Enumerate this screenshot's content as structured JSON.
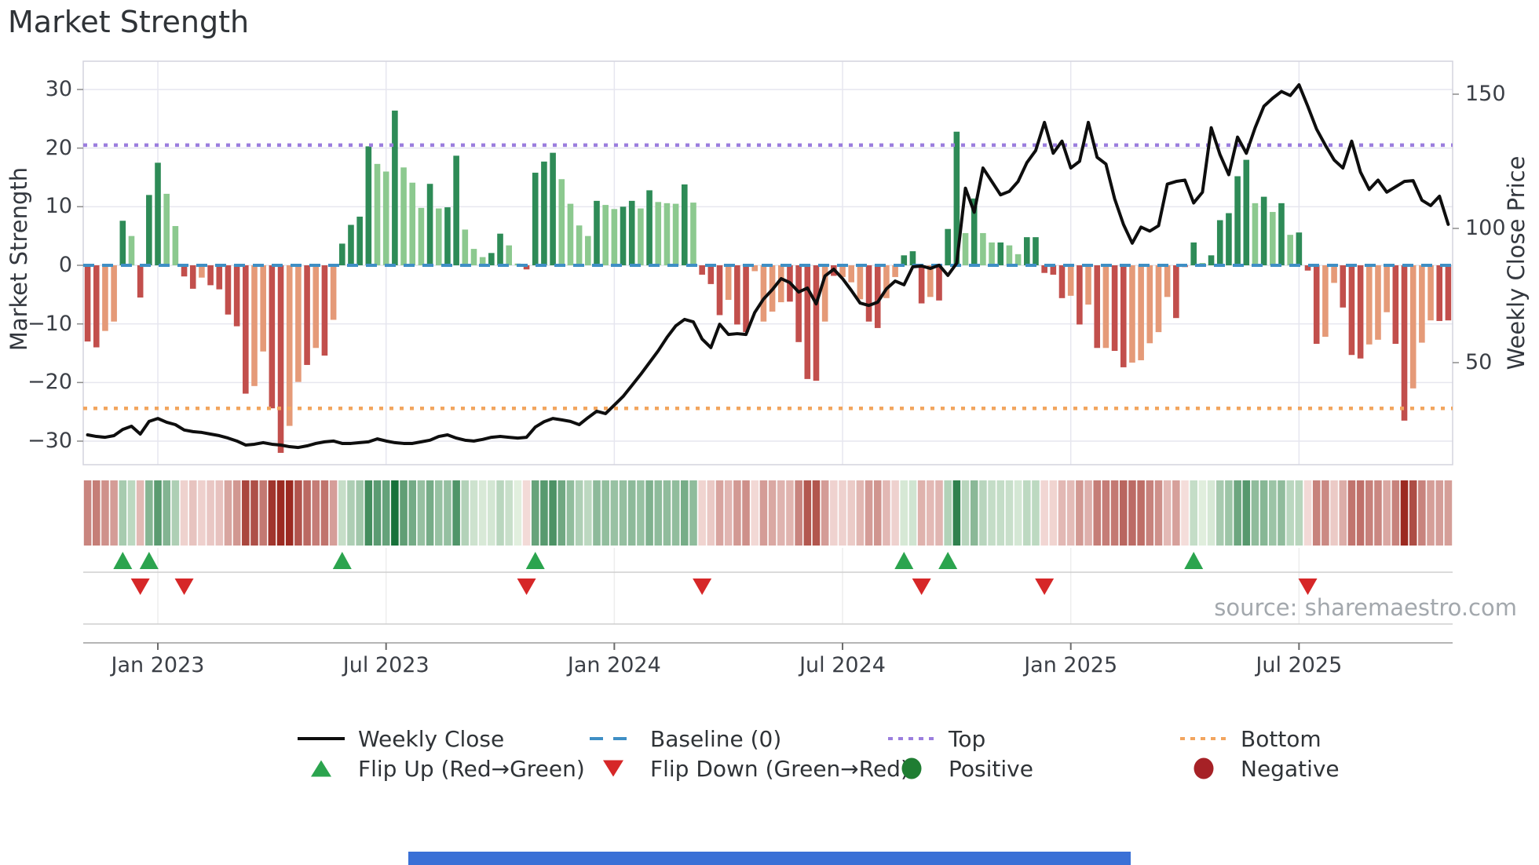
{
  "title": "Market Strength",
  "source": "source: sharemaestro.com",
  "chart_data": {
    "type": "combo",
    "title": "Market Strength",
    "ylabel_left": "Market Strength",
    "ylabel_right": "Weekly Close Price",
    "x_tick_labels": [
      "Jan 2023",
      "Jul 2023",
      "Jan 2024",
      "Jul 2024",
      "Jan 2025",
      "Jul 2025"
    ],
    "x_tick_weeks": [
      8,
      34,
      60,
      86,
      112,
      138
    ],
    "y_ticks_left_values": [
      30,
      20,
      10,
      0,
      -10,
      -20,
      -30
    ],
    "y_ticks_left_labels": [
      "30",
      "20",
      "10",
      "0",
      "−10",
      "−20",
      "−30"
    ],
    "y_ticks_right_values": [
      150,
      100,
      50
    ],
    "y_ticks_right_labels": [
      "150",
      "100",
      "50"
    ],
    "ylim_left": [
      -34,
      35
    ],
    "ylim_right": [
      12,
      162
    ],
    "grid": true,
    "legend_position": "bottom",
    "baseline": 0,
    "top_line": 20.5,
    "bottom_line": -24.4,
    "n_weeks": 156,
    "strength": [
      -13,
      -14,
      -11.2,
      -9.6,
      7.6,
      5,
      -5.5,
      12,
      17.5,
      12.2,
      6.7,
      -1.9,
      -4,
      -2.1,
      -3.4,
      -4.1,
      -8.4,
      -10.4,
      -21.9,
      -20.6,
      -14.7,
      -24.4,
      -32,
      -27.4,
      -19.9,
      -17,
      -14.1,
      -15.4,
      -9.3,
      3.7,
      6.9,
      8.3,
      20.3,
      17.3,
      16,
      26.4,
      16.7,
      14.1,
      9.8,
      13.9,
      9.7,
      9.9,
      18.7,
      6.1,
      2.8,
      1.4,
      2.1,
      5.4,
      3.4,
      0.3,
      -0.7,
      15.8,
      17.7,
      19.2,
      14.7,
      10.5,
      6.8,
      5,
      11,
      10.3,
      9.6,
      10,
      11,
      9.7,
      12.8,
      10.8,
      10.6,
      10.5,
      13.8,
      10.7,
      -1.6,
      -3.2,
      -8.5,
      -5.9,
      -10.1,
      -11.4,
      -1,
      -9.6,
      -7.9,
      -6.3,
      -6.2,
      -13.1,
      -19.4,
      -19.7,
      -9.6,
      -1.8,
      -2,
      -2.9,
      -5.8,
      -9.6,
      -10.7,
      -5.6,
      -2,
      1.7,
      2.4,
      -6.5,
      -5.4,
      -6,
      6.2,
      22.8,
      5.5,
      11.4,
      5.5,
      3.9,
      3.9,
      3.4,
      1.9,
      4.8,
      4.8,
      -1.3,
      -1.6,
      -5.6,
      -5.2,
      -10.1,
      -6.7,
      -14.1,
      -14.1,
      -14.6,
      -17.4,
      -16.6,
      -16.2,
      -13.3,
      -11.4,
      -5.4,
      -9,
      -0.3,
      3.9,
      0.4,
      1.7,
      7.7,
      8.9,
      15.2,
      18,
      10.6,
      11.7,
      9.1,
      10.6,
      5.2,
      5.6,
      -0.9,
      -13.4,
      -12.2,
      -3,
      -7.2,
      -15.3,
      -15.9,
      -13.5,
      -12.7,
      -8,
      -13.4,
      -26.5,
      -21,
      -13.2,
      -9.4,
      -9.5,
      -9.4
    ],
    "shade": [
      "dr",
      "dr",
      "lr",
      "lr",
      "dg",
      "lg",
      "dr",
      "dg",
      "dg",
      "lg",
      "lg",
      "dr",
      "dr",
      "lr",
      "dr",
      "dr",
      "dr",
      "dr",
      "dr",
      "lr",
      "lr",
      "dr",
      "dr",
      "lr",
      "lr",
      "dr",
      "lr",
      "dr",
      "lr",
      "dg",
      "dg",
      "dg",
      "dg",
      "lg",
      "lg",
      "dg",
      "lg",
      "lg",
      "lg",
      "dg",
      "lg",
      "dg",
      "dg",
      "lg",
      "lg",
      "lg",
      "dg",
      "dg",
      "lg",
      "lg",
      "dr",
      "dg",
      "dg",
      "dg",
      "lg",
      "lg",
      "lg",
      "lg",
      "dg",
      "lg",
      "lg",
      "dg",
      "dg",
      "lg",
      "dg",
      "lg",
      "lg",
      "lg",
      "dg",
      "lg",
      "dr",
      "dr",
      "dr",
      "lr",
      "dr",
      "dr",
      "lr",
      "lr",
      "lr",
      "lr",
      "dr",
      "dr",
      "dr",
      "dr",
      "lr",
      "dr",
      "lr",
      "lr",
      "lr",
      "dr",
      "dr",
      "lr",
      "lr",
      "dg",
      "dg",
      "dr",
      "lr",
      "dr",
      "dg",
      "dg",
      "lg",
      "dg",
      "lg",
      "lg",
      "dg",
      "lg",
      "lg",
      "dg",
      "dg",
      "dr",
      "dr",
      "dr",
      "lr",
      "dr",
      "lr",
      "dr",
      "lr",
      "dr",
      "dr",
      "lr",
      "lr",
      "lr",
      "lr",
      "lr",
      "dr",
      "dr",
      "dg",
      "lg",
      "dg",
      "dg",
      "dg",
      "dg",
      "dg",
      "lg",
      "dg",
      "lg",
      "dg",
      "lg",
      "dg",
      "dr",
      "dr",
      "lr",
      "lr",
      "dr",
      "dr",
      "dr",
      "lr",
      "lr",
      "lr",
      "dr",
      "dr",
      "lr",
      "lr",
      "lr",
      "dr",
      "dr"
    ],
    "weekly_close": [
      23.1,
      22.5,
      22.2,
      22.8,
      25.1,
      26.3,
      23.4,
      28.1,
      29.2,
      27.8,
      26.9,
      24.9,
      24.3,
      24,
      23.4,
      22.8,
      21.9,
      20.8,
      19.3,
      19.6,
      20.2,
      19.6,
      19.3,
      18.7,
      18.4,
      19,
      19.9,
      20.5,
      20.8,
      19.9,
      19.9,
      20.2,
      20.5,
      21.6,
      20.8,
      20.2,
      19.9,
      19.9,
      20.5,
      21.1,
      22.5,
      23.1,
      21.9,
      21.1,
      20.8,
      21.4,
      22.2,
      22.5,
      22.2,
      21.9,
      22.2,
      26,
      28,
      29.2,
      28.7,
      28.1,
      26.9,
      29.5,
      31.9,
      31,
      34.2,
      37.4,
      41.5,
      45.6,
      50,
      54.4,
      59.4,
      63.7,
      66.1,
      65.2,
      58.8,
      55.6,
      64.3,
      60.5,
      60.8,
      60.5,
      68.7,
      73.7,
      77.2,
      81.3,
      79.8,
      76.3,
      77.8,
      71.9,
      82.3,
      84.8,
      81.3,
      76.9,
      72.2,
      71.3,
      72.5,
      77.5,
      80.4,
      79,
      85.7,
      86,
      85.1,
      86.3,
      82.5,
      87,
      115,
      106,
      122.5,
      117.5,
      112.5,
      113.8,
      117.5,
      124.5,
      129,
      139.5,
      128,
      132.5,
      122.5,
      125,
      139.5,
      126.5,
      124,
      111,
      101.5,
      94.5,
      100.5,
      99,
      101,
      116.5,
      117.5,
      118,
      109.5,
      113.5,
      137.5,
      127.5,
      120,
      134,
      128,
      137.5,
      145.5,
      148.5,
      151,
      149.5,
      153.5,
      145.5,
      137,
      131,
      125.5,
      122.5,
      132.5,
      121,
      114.5,
      118,
      113.5,
      115.5,
      117.5,
      117.8,
      110.5,
      108.5,
      112,
      101.5
    ],
    "flip_up_weeks": [
      4,
      7,
      29,
      51,
      93,
      98,
      126
    ],
    "flip_down_weeks": [
      6,
      11,
      50,
      70,
      95,
      109,
      139
    ]
  },
  "legend": {
    "rows": [
      [
        {
          "swatch": "line-black",
          "label": "Weekly Close"
        },
        {
          "swatch": "dash-blue",
          "label": "Baseline (0)"
        },
        {
          "swatch": "dot-purple",
          "label": "Top"
        },
        {
          "swatch": "dot-orange",
          "label": "Bottom"
        }
      ],
      [
        {
          "swatch": "tri-up",
          "label": "Flip Up (Red→Green)"
        },
        {
          "swatch": "tri-down",
          "label": "Flip Down (Green→Red)"
        },
        {
          "swatch": "circle-green",
          "label": "Positive"
        },
        {
          "swatch": "circle-red",
          "label": "Negative"
        }
      ]
    ]
  },
  "colors": {
    "bar_dark_green": "#2e8b57",
    "bar_light_green": "#8cc98f",
    "bar_dark_red": "#c24f4c",
    "bar_light_red": "#e59a78",
    "baseline_blue": "#3f8fc5",
    "top_purple": "#9b7ede",
    "bottom_orange": "#f2a55e",
    "price_line": "#0e0e0e",
    "flip_up": "#2ba44e",
    "flip_down": "#d62728",
    "positive": "#1f7d32",
    "negative": "#a62126",
    "heat_pos_max": "#17713a",
    "heat_pos_min": "#e3f0e0",
    "heat_neg_max": "#9c2a21",
    "heat_neg_min": "#f5dfdc",
    "grid": "#e6e6ef",
    "spine": "#d4d4dd",
    "footer_bar": "#3a70d6"
  }
}
